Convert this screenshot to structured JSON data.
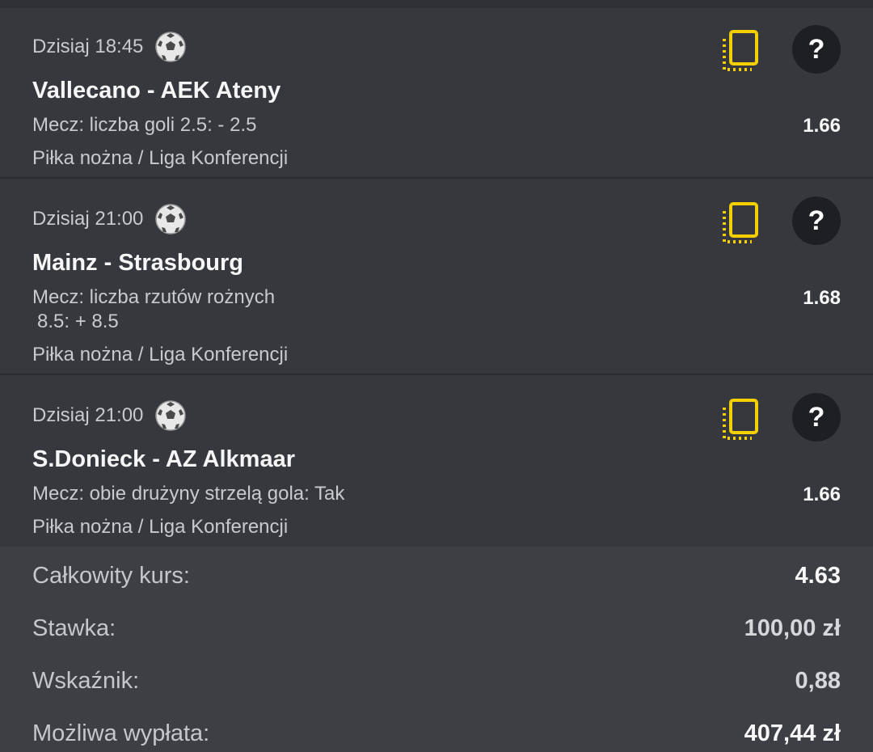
{
  "bets": [
    {
      "time": "Dzisiaj 18:45",
      "sport_icon": "soccer-ball-icon",
      "match": "Vallecano - AEK Ateny",
      "market_line1": "Mecz: liczba goli 2.5: - 2.5",
      "market_line2": "",
      "league": "Piłka nożna / Liga Konferencji",
      "odd": "1.66"
    },
    {
      "time": "Dzisiaj 21:00",
      "sport_icon": "soccer-ball-icon",
      "match": "Mainz - Strasbourg",
      "market_line1": "Mecz: liczba rzutów rożnych",
      "market_line2": "8.5: + 8.5",
      "league": "Piłka nożna / Liga Konferencji",
      "odd": "1.68"
    },
    {
      "time": "Dzisiaj 21:00",
      "sport_icon": "soccer-ball-icon",
      "match": "S.Donieck - AZ Alkmaar",
      "market_line1": "Mecz: obie drużyny strzelą gola: Tak",
      "market_line2": "",
      "league": "Piłka nożna / Liga Konferencji",
      "odd": "1.66"
    }
  ],
  "help_label": "?",
  "summary": {
    "total_odds_label": "Całkowity kurs:",
    "total_odds_value": "4.63",
    "stake_label": "Stawka:",
    "stake_value": "100,00 zł",
    "indicator_label": "Wskaźnik:",
    "indicator_value": "0,88",
    "payout_label": "Możliwa wypłata:",
    "payout_value": "407,44 zł"
  },
  "colors": {
    "accent": "#f5d000",
    "card_bg": "#36383d",
    "summary_bg": "#3d3f45",
    "page_bg": "#2b2d32"
  }
}
